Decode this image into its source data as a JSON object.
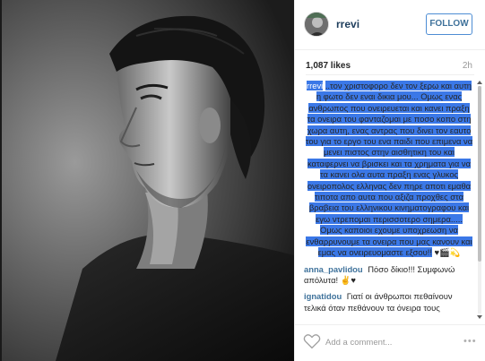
{
  "post": {
    "username": "rrevi",
    "follow_label": "FOLLOW",
    "likes": "1,087 likes",
    "time": "2h",
    "caption_user": "rrevi",
    "caption_text": "..τον χριστοφορο δεν τον ξερω και αυτη η φωτο δεν εναι δικια μου... Ομως ενας ανθρωπος που ονειρευεται και κανει πραξη τα ονειρα του φανταζομαι με ποσο κοπο στη χωρα αυτη, ενας αντρας που δινει τον εαυτο του για το εργο του ενα παιδι που επιμενα να μενει πιστος στην αισθητικη του και καταφερνει να βρισκει και τα χρηματα για να τα κανει ολα αυτα πραξη ενας γλυκος ονειροπολος ελληνας δεν πηρε αποτι εμαθα τιποτα απο αυτα που αξιζα προχθες στα βραβεια του ελληνικου κινηματογραφου και εγω ντρεπομαι περισσοτερο σημερα..... Ομως καποιοι εχουμε υποχρεωση να ενθαρρυνουμε τα ονειρα που μας κανουν και εμας να ονειρευομαστε εξσου!!",
    "caption_emoji": "♥🎬💫",
    "comments": [
      {
        "user": "anna_pavlidou",
        "text": "Πόσο δίκιο!!! Συμφωνώ απόλυτα!",
        "emoji": "✌♥"
      },
      {
        "user": "ignatidou",
        "text": "Γιατί οι άνθρωποι πεθαίνουν τελικά όταν πεθάνουν τα όνειρα τους"
      }
    ],
    "add_comment_placeholder": "Add a comment...",
    "more_label": "•••"
  },
  "icons": {
    "heart": "heart-icon",
    "avatar": "avatar"
  },
  "colors": {
    "selection": "#3b78e7",
    "follow_border": "#4d8dd4",
    "username": "#1e3d5c",
    "link": "#3f729b"
  }
}
